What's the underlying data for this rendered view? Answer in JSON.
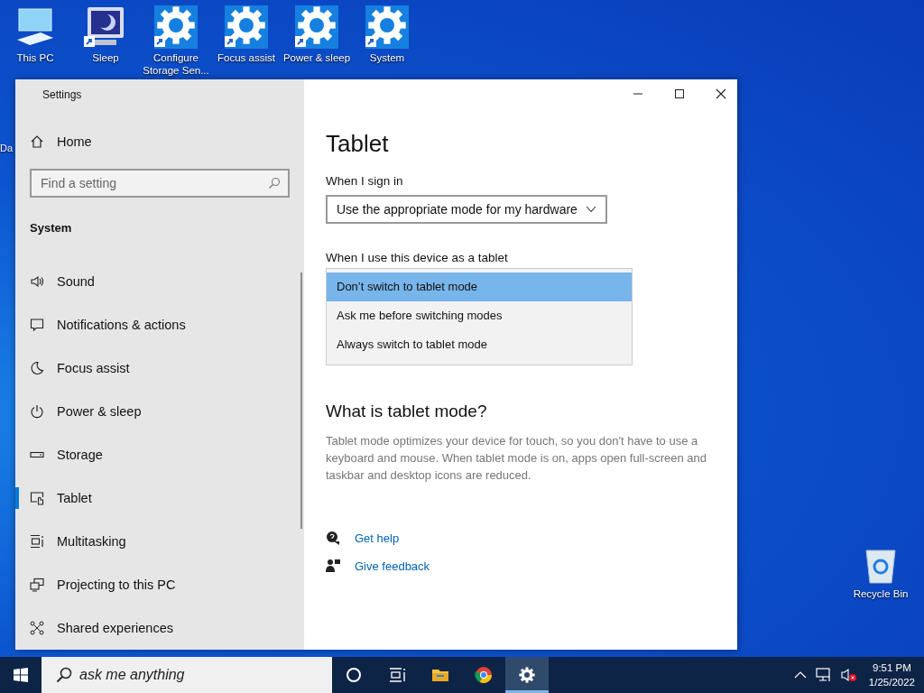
{
  "desktop_icons": [
    {
      "label": "This PC",
      "kind": "pc",
      "shortcut": false
    },
    {
      "label": "Sleep",
      "kind": "sleep",
      "shortcut": true
    },
    {
      "label": "Configure Storage Sen...",
      "kind": "gear",
      "shortcut": true
    },
    {
      "label": "Focus assist",
      "kind": "gear",
      "shortcut": true
    },
    {
      "label": "Power & sleep",
      "kind": "gear",
      "shortcut": true
    },
    {
      "label": "System",
      "kind": "gear",
      "shortcut": true
    }
  ],
  "hidden_icon_label": "Da",
  "recycle_bin": {
    "label": "Recycle Bin"
  },
  "window": {
    "title": "Settings",
    "sidebar": {
      "home": "Home",
      "search": {
        "placeholder": "Find a setting"
      },
      "section": "System",
      "items": [
        {
          "label": "Sound",
          "kind": "sound",
          "selected": false
        },
        {
          "label": "Notifications & actions",
          "kind": "notifications",
          "selected": false
        },
        {
          "label": "Focus assist",
          "kind": "moon",
          "selected": false
        },
        {
          "label": "Power & sleep",
          "kind": "power",
          "selected": false
        },
        {
          "label": "Storage",
          "kind": "storage",
          "selected": false
        },
        {
          "label": "Tablet",
          "kind": "tablet",
          "selected": true
        },
        {
          "label": "Multitasking",
          "kind": "multitask",
          "selected": false
        },
        {
          "label": "Projecting to this PC",
          "kind": "project",
          "selected": false
        },
        {
          "label": "Shared experiences",
          "kind": "shared",
          "selected": false
        }
      ]
    },
    "main": {
      "title": "Tablet",
      "sign_in_label": "When I sign in",
      "sign_in_dropdown": {
        "value": "Use the appropriate mode for my hardware"
      },
      "tablet_label": "When I use this device as a tablet",
      "tablet_options": [
        {
          "label": "Don’t switch to tablet mode",
          "selected": true
        },
        {
          "label": "Ask me before switching modes",
          "selected": false
        },
        {
          "label": "Always switch to tablet mode",
          "selected": false
        }
      ],
      "heading": "What is tablet mode?",
      "description": "Tablet mode optimizes your device for touch, so you don't have to use a keyboard and mouse. When tablet mode is on, apps open full-screen and taskbar and desktop icons are reduced.",
      "links": [
        {
          "label": "Get help",
          "kind": "help"
        },
        {
          "label": "Give feedback",
          "kind": "feedback"
        }
      ]
    }
  },
  "taskbar": {
    "search": {
      "placeholder": "ask me anything"
    },
    "apps": [
      {
        "kind": "cortana",
        "active": false
      },
      {
        "kind": "taskview",
        "active": false
      },
      {
        "kind": "explorer",
        "active": false
      },
      {
        "kind": "chrome",
        "active": false
      },
      {
        "kind": "settings",
        "active": true
      }
    ],
    "time": "9:51 PM",
    "date": "1/25/2022"
  }
}
